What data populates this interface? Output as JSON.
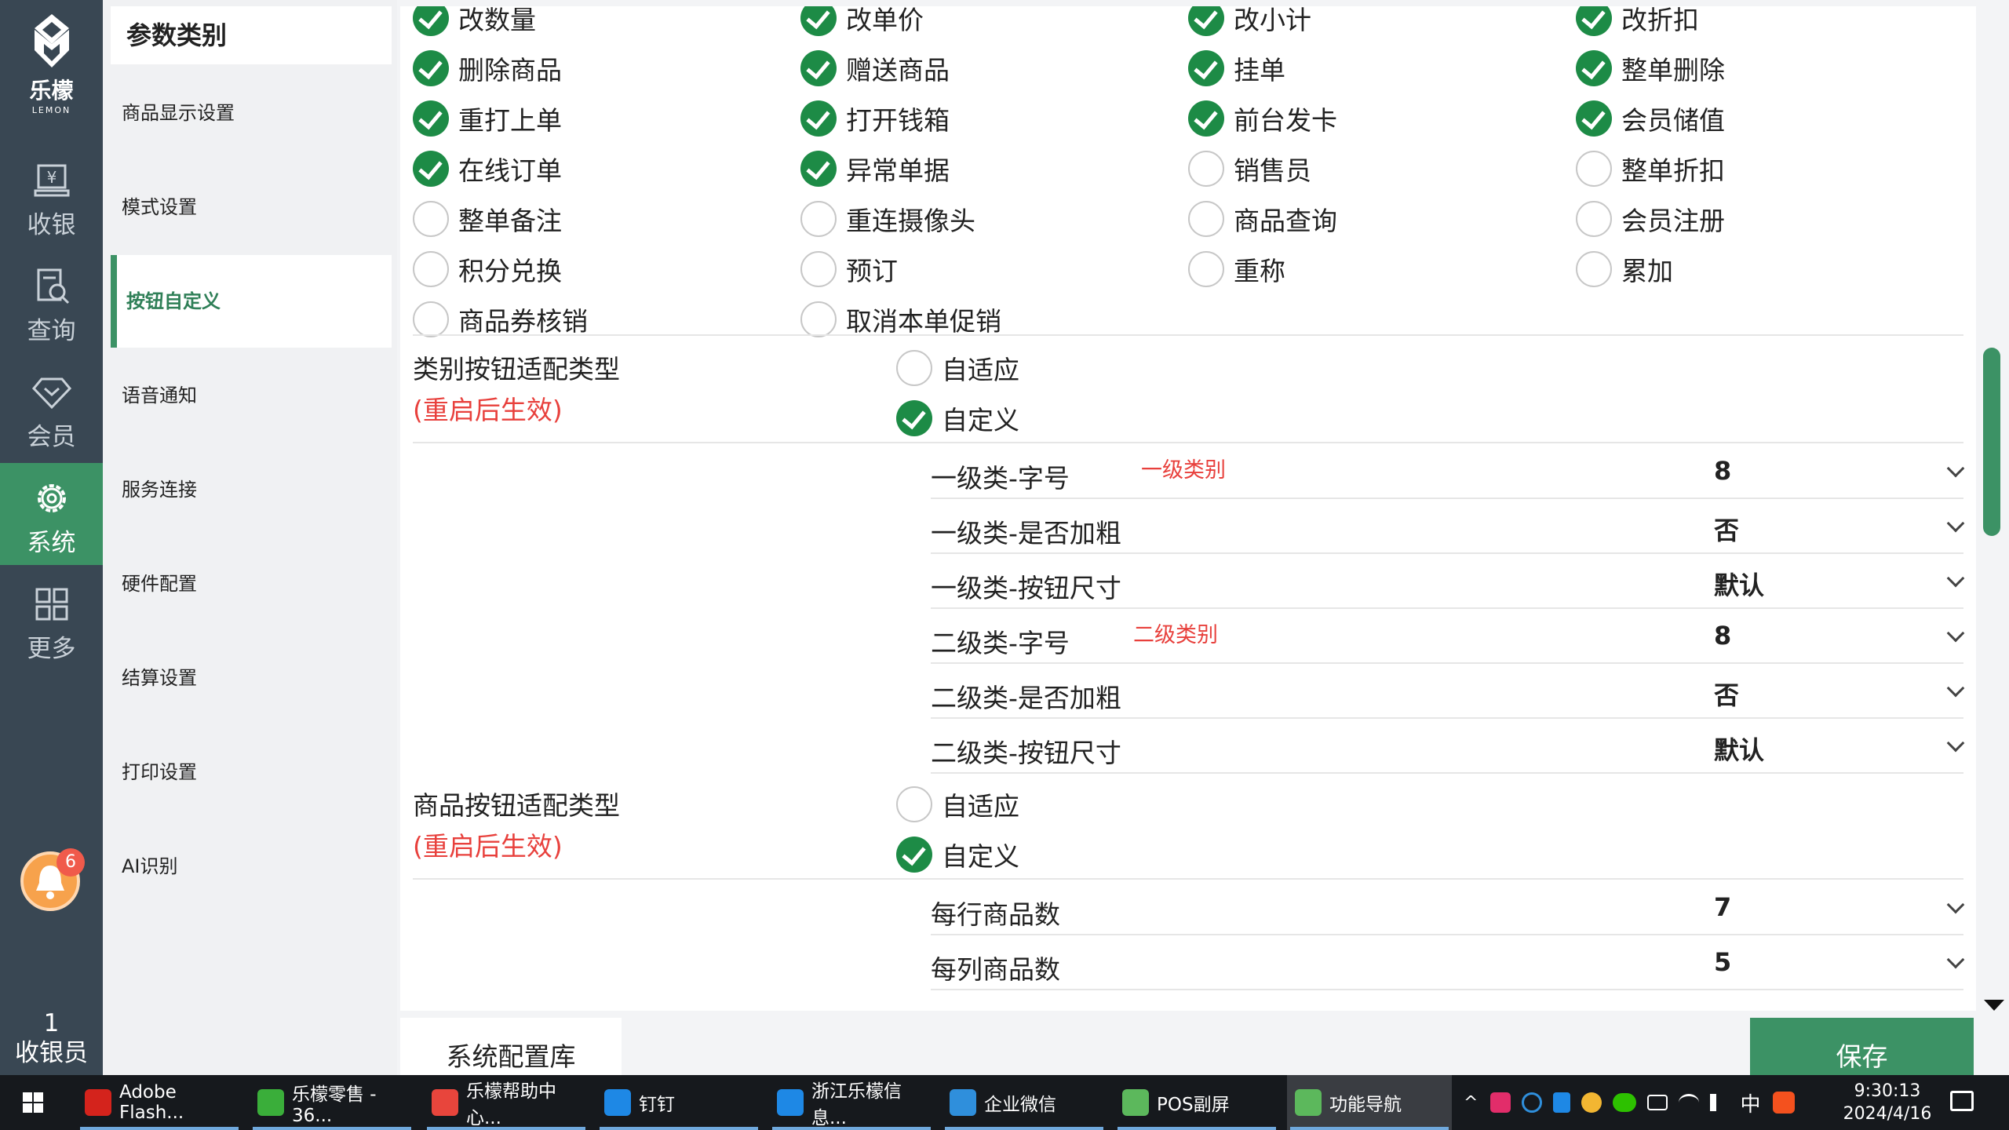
{
  "rail": {
    "logo_cn": "乐檬",
    "logo_en": "LEMON",
    "items": [
      {
        "label": "收银",
        "icon": "cash-register-icon"
      },
      {
        "label": "查询",
        "icon": "search-doc-icon"
      },
      {
        "label": "会员",
        "icon": "diamond-icon"
      },
      {
        "label": "系统",
        "icon": "gear-icon"
      },
      {
        "label": "更多",
        "icon": "grid-icon"
      }
    ],
    "notification_count": "6",
    "user_number": "1",
    "user_role": "收银员"
  },
  "categories": {
    "title": "参数类别",
    "items": [
      "商品显示设置",
      "模式设置",
      "按钮自定义",
      "语音通知",
      "服务连接",
      "硬件配置",
      "结算设置",
      "打印设置",
      "AI识别"
    ],
    "active_index": 2
  },
  "buttons": [
    [
      "改数量",
      "改单价",
      "改小计",
      "改折扣"
    ],
    [
      "删除商品",
      "赠送商品",
      "挂单",
      "整单删除"
    ],
    [
      "重打上单",
      "打开钱箱",
      "前台发卡",
      "会员储值"
    ],
    [
      "在线订单",
      "异常单据",
      "销售员",
      "整单折扣"
    ],
    [
      "整单备注",
      "重连摄像头",
      "商品查询",
      "会员注册"
    ],
    [
      "积分兑换",
      "预订",
      "重称",
      "累加"
    ],
    [
      "商品券核销",
      "取消本单促销",
      "",
      ""
    ]
  ],
  "checked": [
    [
      true,
      true,
      true,
      true
    ],
    [
      true,
      true,
      true,
      true
    ],
    [
      true,
      true,
      true,
      true
    ],
    [
      true,
      true,
      false,
      false
    ],
    [
      false,
      false,
      false,
      false
    ],
    [
      false,
      false,
      false,
      false
    ],
    [
      false,
      false,
      false,
      false
    ]
  ],
  "category_fit": {
    "title": "类别按钮适配类型",
    "note": "(重启后生效)",
    "opt_adaptive": "自适应",
    "opt_custom": "自定义",
    "selected": "自定义",
    "rows": [
      {
        "label": "一级类-字号",
        "tag": "一级类别",
        "value": "8"
      },
      {
        "label": "一级类-是否加粗",
        "tag": "",
        "value": "否"
      },
      {
        "label": "一级类-按钮尺寸",
        "tag": "",
        "value": "默认"
      },
      {
        "label": "二级类-字号",
        "tag": "二级类别",
        "value": "8"
      },
      {
        "label": "二级类-是否加粗",
        "tag": "",
        "value": "否"
      },
      {
        "label": "二级类-按钮尺寸",
        "tag": "",
        "value": "默认"
      }
    ]
  },
  "goods_fit": {
    "title": "商品按钮适配类型",
    "note": "(重启后生效)",
    "opt_adaptive": "自适应",
    "opt_custom": "自定义",
    "selected": "自定义",
    "rows": [
      {
        "label": "每行商品数",
        "value": "7"
      },
      {
        "label": "每列商品数",
        "value": "5"
      }
    ]
  },
  "bottom": {
    "tab_label": "系统配置库",
    "save_label": "保存"
  },
  "taskbar": {
    "apps": [
      {
        "label": "Adobe Flash...",
        "color": "#d4231c"
      },
      {
        "label": "乐檬零售 - 36...",
        "color": "#3aae3a"
      },
      {
        "label": "乐檬帮助中心...",
        "color": "#e8453c"
      },
      {
        "label": "钉钉",
        "color": "#1e88e5"
      },
      {
        "label": "浙江乐檬信息...",
        "color": "#1e88e5"
      },
      {
        "label": "企业微信",
        "color": "#2f8fdc"
      },
      {
        "label": "POS副屏",
        "color": "#5cb85c"
      },
      {
        "label": "功能导航",
        "color": "#5cb85c"
      }
    ],
    "ime": "中",
    "time": "9:30:13",
    "date": "2024/4/16"
  }
}
